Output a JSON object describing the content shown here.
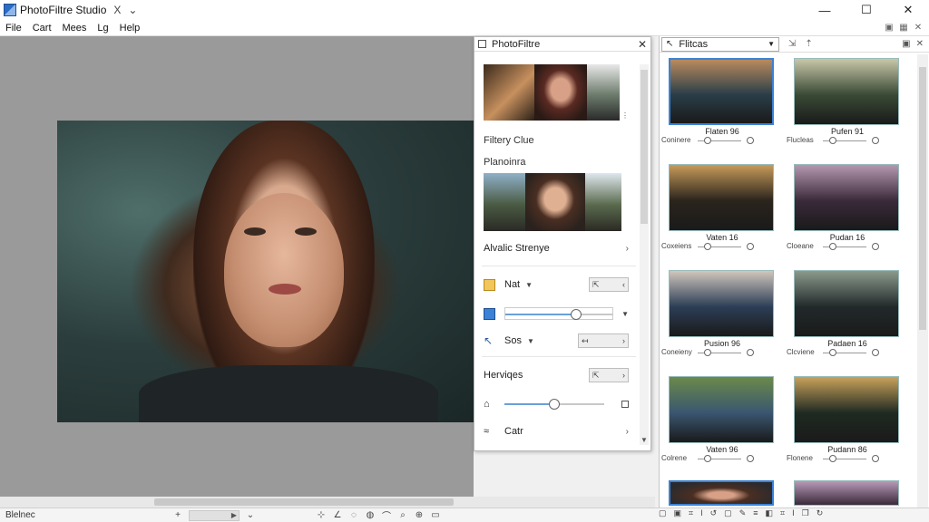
{
  "window": {
    "title": "PhotoFiltre Studio",
    "title_extra": "X",
    "controls": [
      "—",
      "☐",
      "✕"
    ]
  },
  "menu": {
    "items": [
      "File",
      "Cart",
      "Mees",
      "Lg",
      "Help"
    ]
  },
  "status": {
    "text": "Blelnec"
  },
  "pf_panel": {
    "title": "PhotoFiltre",
    "section1": "Filtery Clue",
    "section2": "Planoinra",
    "section3": "Alvalic Strenye",
    "row_nat": "Nat",
    "row_sos": "Sos",
    "section4": "Herviqes",
    "row_cat": "Catr",
    "slider1_value": 0.66,
    "slider2_value": 0.5
  },
  "filters": {
    "combo_label": "Flitcas",
    "tiles": [
      {
        "name": "Flaten 96",
        "ctl": "Coninere",
        "value": 0.18,
        "selected": true,
        "palette": [
          "#2a3e48",
          "#b98a5e"
        ]
      },
      {
        "name": "Pufen 91",
        "ctl": "Flucleas",
        "value": 0.18,
        "selected": false,
        "palette": [
          "#3a4a36",
          "#c9c7a8"
        ]
      },
      {
        "name": "Vaten 16",
        "ctl": "Coxeiens",
        "value": 0.18,
        "selected": false,
        "palette": [
          "#2a241c",
          "#c89a5a"
        ]
      },
      {
        "name": "Pudan 16",
        "ctl": "Cloeane",
        "value": 0.18,
        "selected": false,
        "palette": [
          "#3a2a3a",
          "#b598b0"
        ]
      },
      {
        "name": "Pusion 96",
        "ctl": "Coneieny",
        "value": 0.18,
        "selected": false,
        "palette": [
          "#2c3e56",
          "#d0c6bc"
        ]
      },
      {
        "name": "Padaen 16",
        "ctl": "Clcviene",
        "value": 0.18,
        "selected": false,
        "palette": [
          "#22292a",
          "#8b9a8c"
        ]
      },
      {
        "name": "Vaten 96",
        "ctl": "Colrene",
        "value": 0.18,
        "selected": false,
        "palette": [
          "#3a5670",
          "#6b8a4a"
        ]
      },
      {
        "name": "Pudann 86",
        "ctl": "Flonene",
        "value": 0.18,
        "selected": false,
        "palette": [
          "#1f2a22",
          "#c9a15a"
        ]
      }
    ]
  }
}
